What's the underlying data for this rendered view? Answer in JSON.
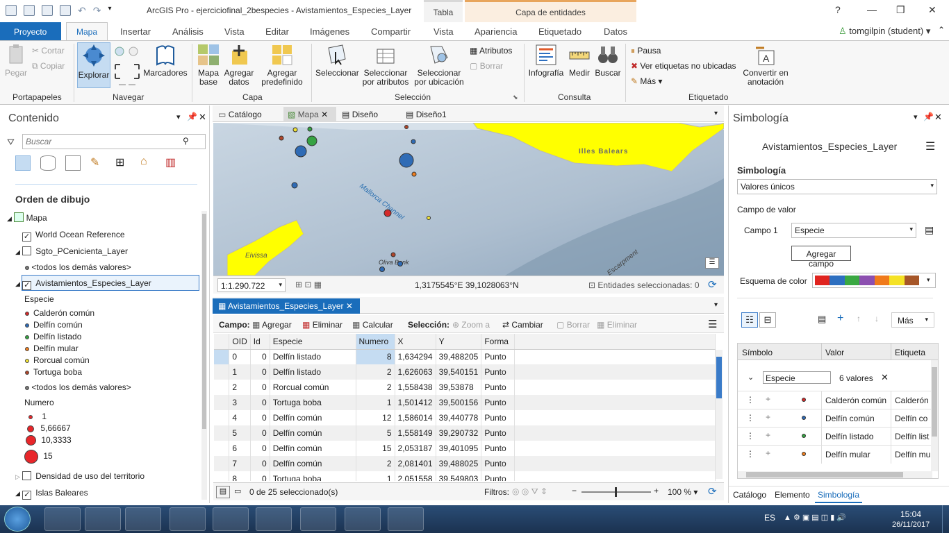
{
  "window": {
    "title": "ArcGIS Pro - ejerciciofinal_2bespecies - Avistamientos_Especies_Layer",
    "context_tab_tabla": "Tabla",
    "context_tab_capa": "Capa de entidades",
    "help": "?",
    "user": "tomgilpin (student) ▾"
  },
  "tabs": {
    "proyecto": "Proyecto",
    "mapa": "Mapa",
    "insertar": "Insertar",
    "analisis": "Análisis",
    "vista": "Vista",
    "editar": "Editar",
    "imagenes": "Imágenes",
    "compartir": "Compartir",
    "vista2": "Vista",
    "apariencia": "Apariencia",
    "etiquetado": "Etiquetado",
    "datos": "Datos"
  },
  "ribbon": {
    "pegar": "Pegar",
    "cortar": "Cortar",
    "copiar": "Copiar",
    "portapapeles": "Portapapeles",
    "explorar": "Explorar",
    "marcadores": "Marcadores",
    "navegar": "Navegar",
    "mapa_base": "Mapa base",
    "agregar_datos": "Agregar datos",
    "agregar_predefinido": "Agregar predefinido",
    "capa": "Capa",
    "seleccionar": "Seleccionar",
    "sel_atributos": "Seleccionar por atributos",
    "sel_ubicacion": "Seleccionar por ubicación",
    "atributos": "Atributos",
    "borrar": "Borrar",
    "seleccion": "Selección",
    "infografia": "Infografía",
    "medir": "Medir",
    "buscar": "Buscar",
    "consulta": "Consulta",
    "pausa": "Pausa",
    "ver_etiquetas": "Ver etiquetas no ubicadas",
    "mas": "Más",
    "convertir": "Convertir en anotación",
    "etiquetado": "Etiquetado"
  },
  "contents": {
    "title": "Contenido",
    "search_placeholder": "Buscar",
    "orden": "Orden de dibujo",
    "mapa": "Mapa",
    "world_ocean": "World Ocean Reference",
    "sgto": "Sgto_PCenicienta_Layer",
    "todos1": "<todos los demás valores>",
    "avist": "Avistamientos_Especies_Layer",
    "especie_heading": "Especie",
    "species": [
      {
        "label": "Calderón común",
        "color": "#d42a2a"
      },
      {
        "label": "Delfín común",
        "color": "#2f6bb5"
      },
      {
        "label": "Delfín listado",
        "color": "#36a343"
      },
      {
        "label": "Delfín mular",
        "color": "#f07f1f"
      },
      {
        "label": "Rorcual común",
        "color": "#f2e435"
      },
      {
        "label": "Tortuga boba",
        "color": "#b0462a"
      }
    ],
    "todos2": "<todos los demás valores>",
    "numero_heading": "Numero",
    "sizes": [
      "1",
      "5,66667",
      "10,3333",
      "15"
    ],
    "densidad": "Densidad de uso del territorio",
    "islas": "Islas Baleares"
  },
  "view_tabs": {
    "catalogo": "Catálogo",
    "mapa": "Mapa",
    "diseno": "Diseño",
    "diseno1": "Diseño1"
  },
  "map": {
    "label_baleares": "Illes Balears",
    "label_eivissa": "Eivissa",
    "label_channel": "Mallorca Channel",
    "label_oliva": "Oliva Bank",
    "label_escarpment": "Escarpment",
    "scale": "1:1.290.722",
    "coords": "1,3175545°E 39,1028063°N",
    "selected": "Entidades seleccionadas: 0"
  },
  "table": {
    "tab_label": "Avistamientos_Especies_Layer",
    "campo": "Campo:",
    "agregar": "Agregar",
    "eliminar": "Eliminar",
    "calcular": "Calcular",
    "seleccion": "Selección:",
    "zoom": "Zoom a",
    "cambiar": "Cambiar",
    "borrar": "Borrar",
    "eliminar2": "Eliminar",
    "columns": [
      "OID",
      "Id",
      "Especie",
      "Numero",
      "X",
      "Y",
      "Forma"
    ],
    "rows": [
      [
        "0",
        "0",
        "Delfín listado",
        "8",
        "1,634294",
        "39,488205",
        "Punto"
      ],
      [
        "1",
        "0",
        "Delfín listado",
        "2",
        "1,626063",
        "39,540151",
        "Punto"
      ],
      [
        "2",
        "0",
        "Rorcual común",
        "2",
        "1,558438",
        "39,53878",
        "Punto"
      ],
      [
        "3",
        "0",
        "Tortuga boba",
        "1",
        "1,501412",
        "39,500156",
        "Punto"
      ],
      [
        "4",
        "0",
        "Delfín común",
        "12",
        "1,586014",
        "39,440778",
        "Punto"
      ],
      [
        "5",
        "0",
        "Delfín común",
        "5",
        "1,558149",
        "39,290732",
        "Punto"
      ],
      [
        "6",
        "0",
        "Delfín común",
        "15",
        "2,053187",
        "39,401095",
        "Punto"
      ],
      [
        "7",
        "0",
        "Delfín común",
        "2",
        "2,081401",
        "39,488025",
        "Punto"
      ],
      [
        "8",
        "0",
        "Tortuga boba",
        "1",
        "2,051558",
        "39,549803",
        "Punto"
      ]
    ],
    "status": "0 de 25 seleccionado(s)",
    "filtros": "Filtros:",
    "zoom_pct": "100 %"
  },
  "symbology": {
    "title": "Simbología",
    "layer": "Avistamientos_Especies_Layer",
    "heading": "Simbología",
    "method": "Valores únicos",
    "campo_valor": "Campo de valor",
    "campo1": "Campo 1",
    "campo1_value": "Especie",
    "agregar_campo": "Agregar campo",
    "esquema": "Esquema de color",
    "scheme_colors": [
      "#e0241f",
      "#2d6fc0",
      "#3aa842",
      "#8c4fb0",
      "#f07a1a",
      "#f5e225",
      "#a65628"
    ],
    "mas": "Más",
    "col_simbolo": "Símbolo",
    "col_valor": "Valor",
    "col_etiqueta": "Etiqueta",
    "group_field": "Especie",
    "group_count": "6 valores",
    "items": [
      {
        "valor": "Calderón común",
        "etiqueta": "Calderón",
        "color": "#d42a2a"
      },
      {
        "valor": "Delfín común",
        "etiqueta": "Delfín co",
        "color": "#2f6bb5"
      },
      {
        "valor": "Delfín listado",
        "etiqueta": "Delfín list",
        "color": "#36a343"
      },
      {
        "valor": "Delfín mular",
        "etiqueta": "Delfín mu",
        "color": "#f07f1f"
      }
    ],
    "bottom_tabs": [
      "Catálogo",
      "Elemento",
      "Simbología"
    ]
  },
  "taskbar": {
    "lang": "ES",
    "time": "15:04",
    "date": "26/11/2017"
  }
}
